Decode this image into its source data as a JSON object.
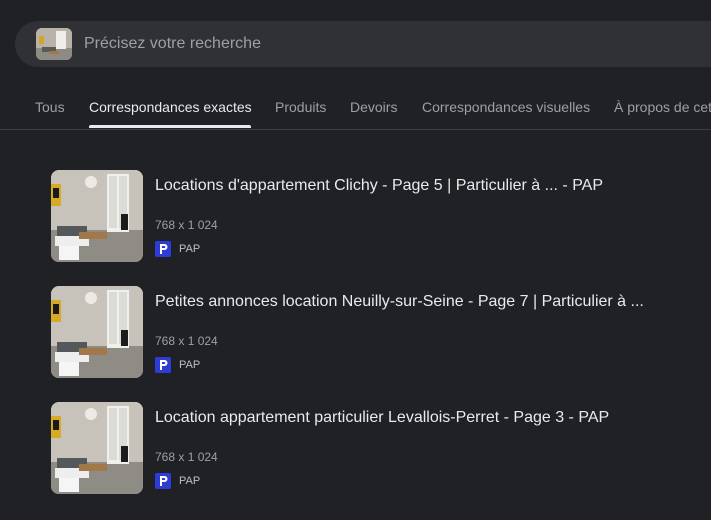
{
  "search": {
    "placeholder": "Précisez votre recherche"
  },
  "tabs": [
    {
      "label": "Tous"
    },
    {
      "label": "Correspondances exactes"
    },
    {
      "label": "Produits"
    },
    {
      "label": "Devoirs"
    },
    {
      "label": "Correspondances visuelles"
    },
    {
      "label": "À propos de cette image"
    }
  ],
  "active_tab": "Correspondances exactes",
  "results": [
    {
      "title": "Locations d'appartement Clichy - Page 5 | Particulier à ... - PAP",
      "dimensions": "768 x 1 024",
      "source": "PAP"
    },
    {
      "title": "Petites annonces location Neuilly-sur-Seine - Page 7 | Particulier à ...",
      "dimensions": "768 x 1 024",
      "source": "PAP"
    },
    {
      "title": "Location appartement particulier Levallois-Perret - Page 3 - PAP",
      "dimensions": "768 x 1 024",
      "source": "PAP"
    }
  ],
  "colors": {
    "background": "#202124",
    "search_bg": "#303134",
    "pap_favicon": "#2e3bd6"
  },
  "icons": {
    "favicon": "pap-favicon-icon",
    "thumbnail": "apartment-photo"
  }
}
